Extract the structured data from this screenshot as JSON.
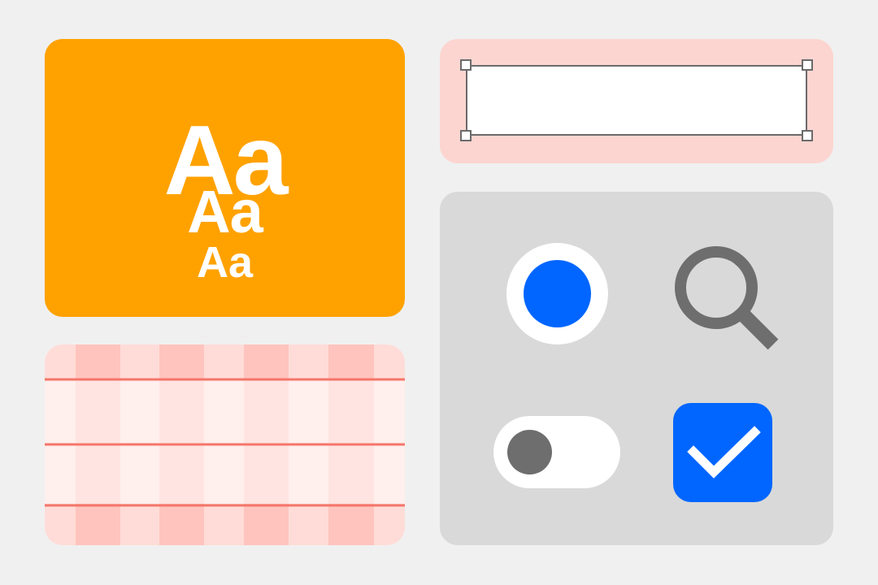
{
  "colors": {
    "background": "#f0f0f0",
    "typography_card": "#ffa200",
    "grid_column_strong": "#ffc4bd",
    "grid_column_light": "#ffdcd8",
    "grid_line": "#f4766a",
    "field_card": "#fdd5d0",
    "controls_card": "#d9d9d9",
    "accent_blue": "#0066ff",
    "icon_gray": "#6e6e6e",
    "white": "#ffffff"
  },
  "typography_card": {
    "samples": [
      "Aa",
      "Aa",
      "Aa"
    ]
  },
  "layout_grid_card": {
    "columns": 8,
    "horizontal_lines": 3
  },
  "text_field_card": {
    "value": "",
    "selection_handles": [
      "top-left",
      "top-right",
      "bottom-left",
      "bottom-right"
    ]
  },
  "controls_card": {
    "radio": {
      "selected": true
    },
    "search": {
      "icon": "search-icon"
    },
    "toggle": {
      "on": false
    },
    "checkbox": {
      "checked": true,
      "icon": "checkmark-icon"
    }
  }
}
